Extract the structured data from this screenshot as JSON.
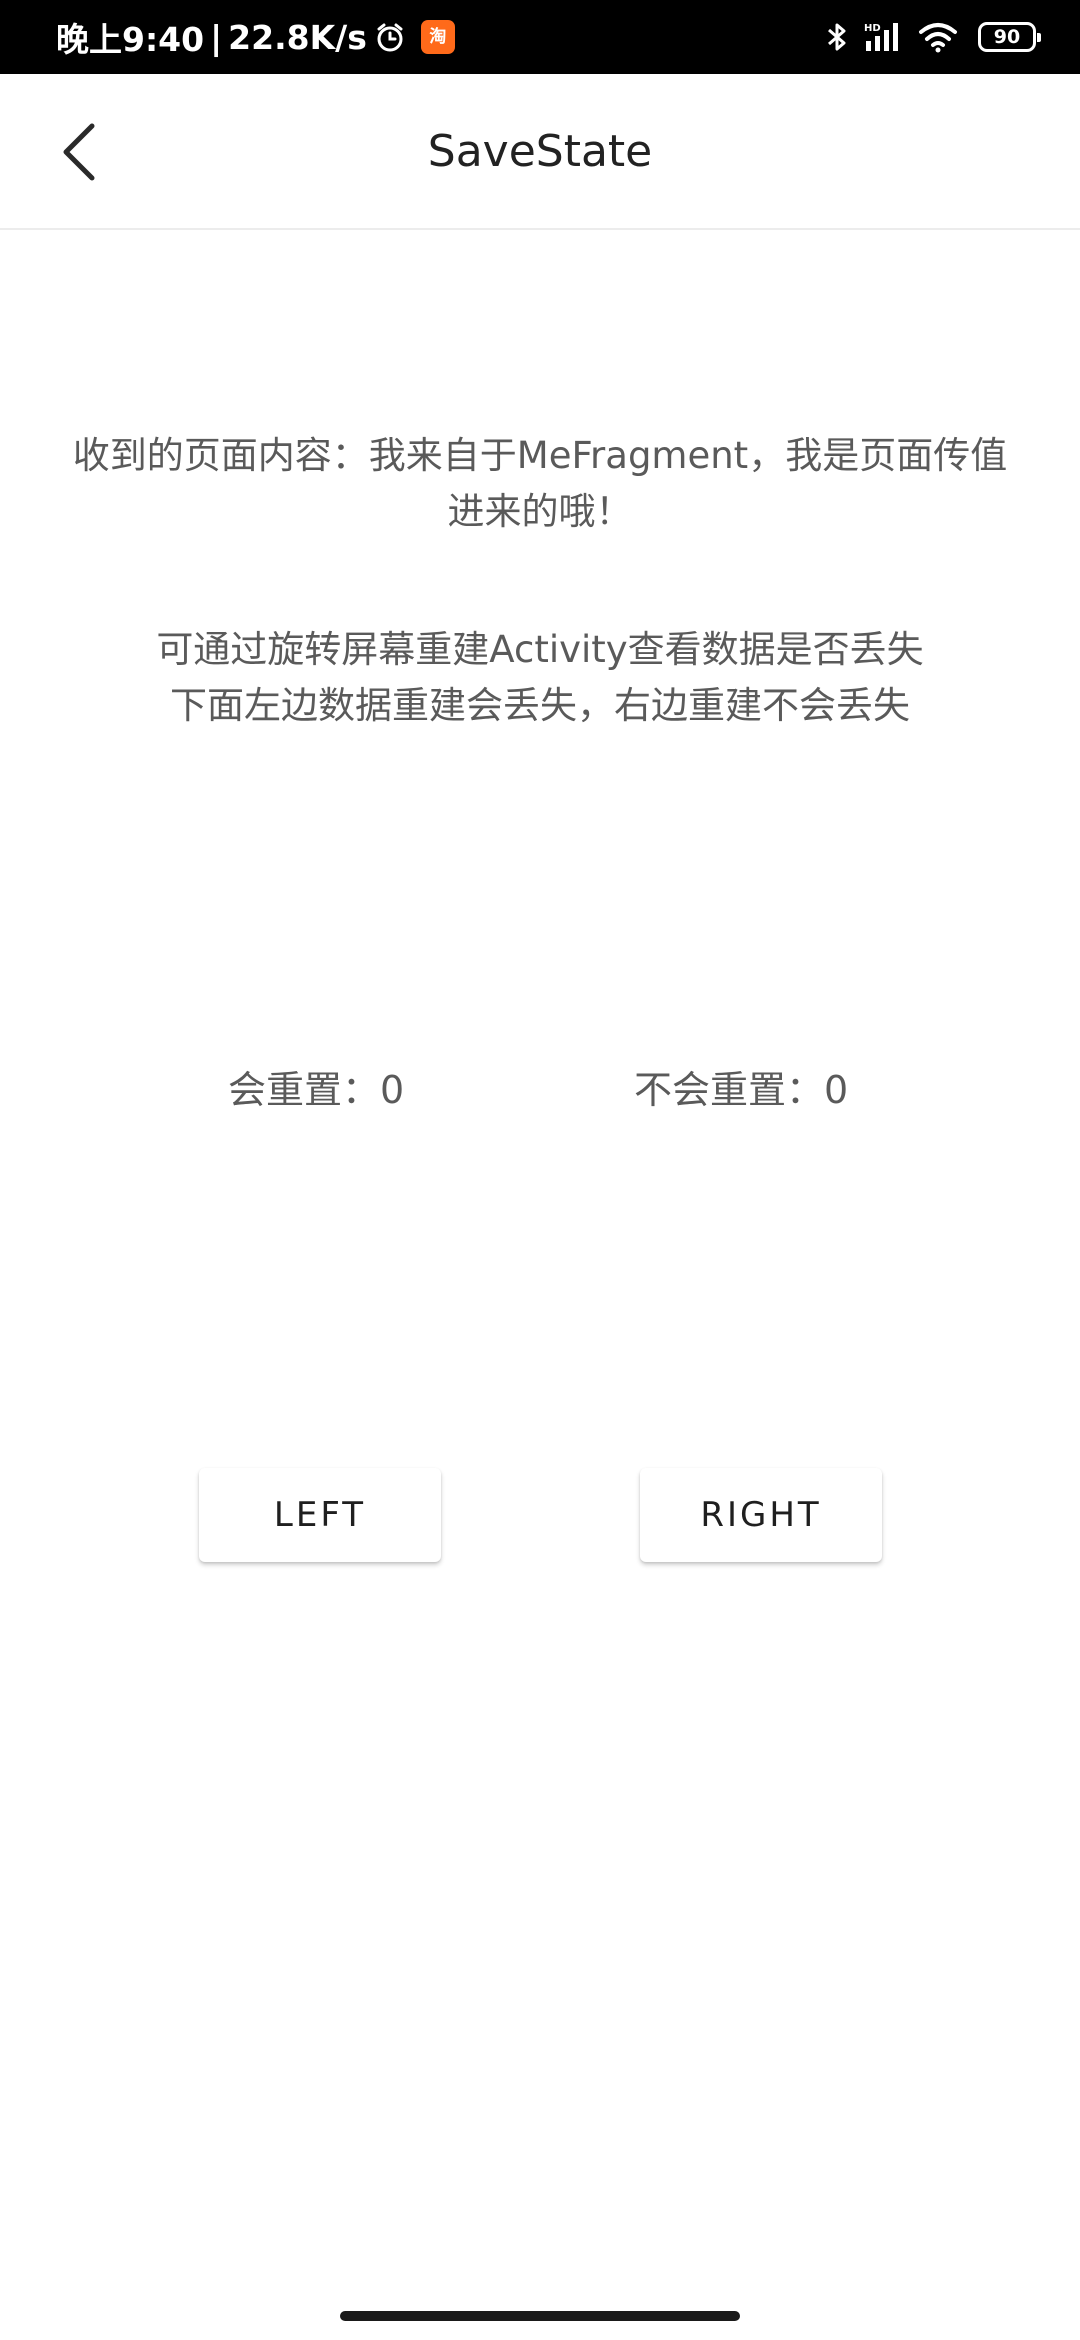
{
  "status_bar": {
    "time": "晚上9:40",
    "separator": "|",
    "net_speed": "22.8K/s",
    "taobao_label": "淘",
    "battery": "90",
    "icons": [
      "alarm-icon",
      "taobao-icon",
      "bluetooth-icon",
      "hd-signal-icon",
      "wifi-icon",
      "battery-icon"
    ]
  },
  "toolbar": {
    "back_icon": "back-arrow-icon",
    "title": "SaveState"
  },
  "content": {
    "received_text": "收到的页面内容：我来自于MeFragment，我是页面传值进来的哦！",
    "hint_line1": "可通过旋转屏幕重建Activity查看数据是否丢失",
    "hint_line2": "下面左边数据重建会丢失，右边重建不会丢失",
    "left_counter": "会重置：0",
    "right_counter": "不会重置：0"
  },
  "buttons": {
    "left_label": "LEFT",
    "right_label": "RIGHT"
  },
  "colors": {
    "status_bar_bg": "#000000",
    "text_gray": "#5a5a5a",
    "title_text": "#222222",
    "taobao_orange": "#ff6a1a"
  }
}
